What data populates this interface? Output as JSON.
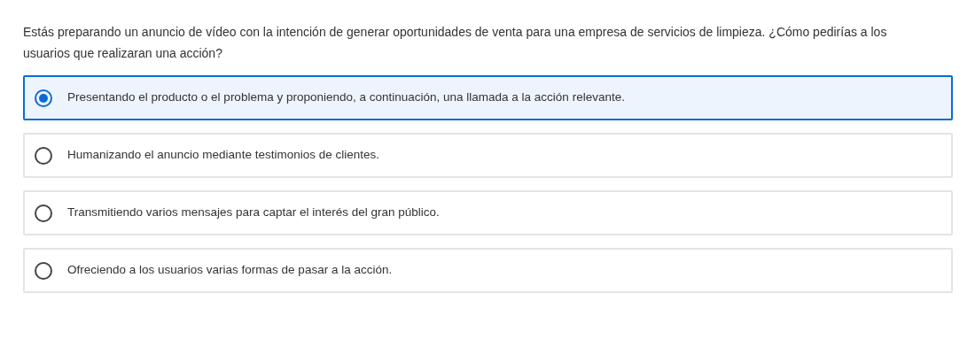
{
  "question": "Estás preparando un anuncio de vídeo con la intención de generar oportunidades de venta para una empresa de servicios de limpieza. ¿Cómo pedirías a los usuarios que realizaran una acción?",
  "options": [
    {
      "label": "Presentando el producto o el problema y proponiendo, a continuación, una llamada a la acción relevante.",
      "selected": true
    },
    {
      "label": "Humanizando el anuncio mediante testimonios de clientes.",
      "selected": false
    },
    {
      "label": "Transmitiendo varios mensajes para captar el interés del gran público.",
      "selected": false
    },
    {
      "label": "Ofreciendo a los usuarios varias formas de pasar a la acción.",
      "selected": false
    }
  ]
}
